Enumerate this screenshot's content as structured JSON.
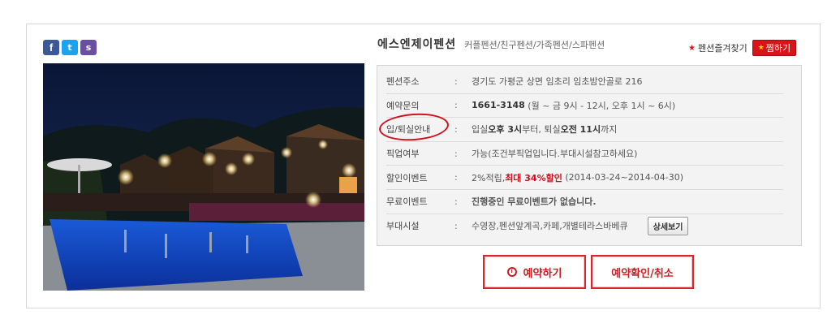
{
  "social": [
    {
      "name": "facebook",
      "glyph": "f"
    },
    {
      "name": "twitter",
      "glyph": "t"
    },
    {
      "name": "kakaostory",
      "glyph": "s"
    }
  ],
  "pension": {
    "name": "에스엔제이펜션",
    "tags": "커플펜션/친구펜션/가족펜션/스파펜션"
  },
  "favorite": {
    "label": "펜션즐겨찾기",
    "button": "찜하기"
  },
  "info": {
    "address": {
      "label": "펜션주소",
      "value": "경기도 가평군 상면 임초리 임초밤안골로 216"
    },
    "contact": {
      "label": "예약문의",
      "phone": "1661-3148",
      "hours": "(월 ~ 금 9시 - 12시, 오후 1시 ~ 6시)"
    },
    "checkin": {
      "label": "입/퇴실안내",
      "pre1": "입실 ",
      "in_time": "오후 3시",
      "mid": "부터, 퇴실 ",
      "out_time": "오전 11시",
      "post": "까지"
    },
    "pickup": {
      "label": "픽업여부",
      "value": "가능(조건부픽업입니다.부대시설참고하세요)"
    },
    "discount": {
      "label": "할인이벤트",
      "pre": "2%적립, ",
      "highlight": "최대 34%할인",
      "period": "(2014-03-24~2014-04-30)"
    },
    "free_event": {
      "label": "무료이벤트",
      "value": "진행중인 무료이벤트가 없습니다."
    },
    "facilities": {
      "label": "부대시설",
      "value": "수영장,펜션앞계곡,카페,개별테라스바베큐",
      "button": "상세보기"
    }
  },
  "actions": {
    "reserve": "예약하기",
    "confirm": "예약확인/취소"
  },
  "colors": {
    "accent": "#d9252b",
    "border": "#d8d8d8",
    "info_bg": "#f3f3f3"
  }
}
